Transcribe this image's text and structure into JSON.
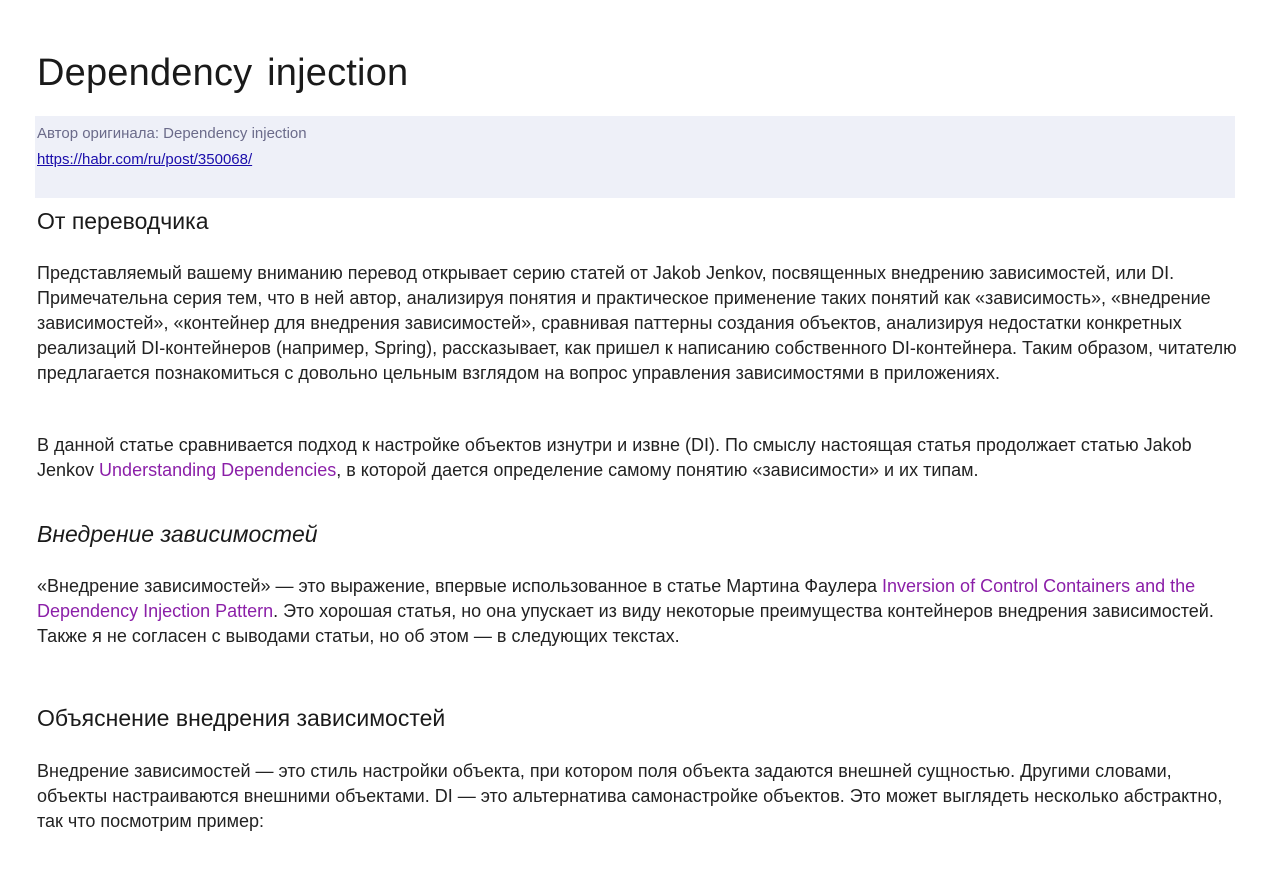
{
  "title": "Dependency injection",
  "meta": {
    "author_label": "Автор оригинала: Dependency injection",
    "url": "https://habr.com/ru/post/350068/"
  },
  "section1": {
    "heading": "От переводчика",
    "p1": "Представляемый вашему вниманию перевод открывает серию статей от Jakob Jenkov, посвященных внедрению зависимостей, или DI. Примечательна серия тем, что в ней автор, анализируя понятия и практическое применение таких понятий как «зависимость», «внедрение зависимостей», «контейнер для внедрения зависимостей», сравнивая паттерны создания объектов, анализируя недостатки конкретных реализаций DI-контейнеров (например, Spring), рассказывает, как пришел к написанию собственного DI-контейнера. Таким образом, читателю предлагается познакомиться с довольно цельным взглядом на вопрос управления зависимостями в приложениях.",
    "p2_before": "В данной статье сравнивается подход к настройке объектов изнутри и извне (DI). По смыслу настоящая статья продолжает статью Jakob Jenkov ",
    "p2_link": "Understanding Dependencies",
    "p2_after": ", в которой дается определение самому понятию «зависимости» и их типам."
  },
  "section2": {
    "heading": "Внедрение зависимостей",
    "p_before": "«Внедрение зависимостей» — это выражение, впервые использованное в статье Мартина Фаулера ",
    "p_link": "Inversion of Control Containers and the Dependency Injection Pattern",
    "p_after": ". Это хорошая статья, но она упускает из виду некоторые преимущества контейнеров внедрения зависимостей. Также я не согласен с выводами статьи, но об этом — в следующих текстах."
  },
  "section3": {
    "heading": "Объяснение внедрения зависимостей",
    "p": "Внедрение зависимостей — это стиль настройки объекта, при котором поля объекта задаются внешней сущностью. Другими словами, объекты настраиваются внешними объектами. DI — это альтернатива самонастройке объектов. Это может выглядеть несколько абстрактно, так что посмотрим пример:"
  }
}
